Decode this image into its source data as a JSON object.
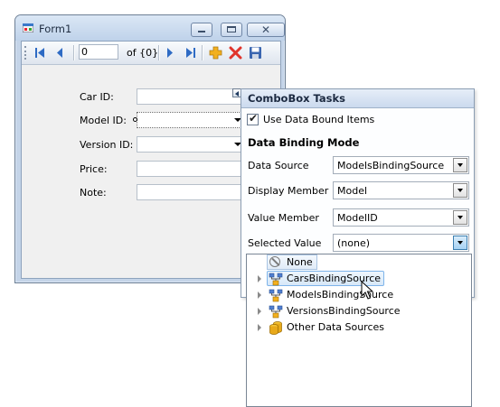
{
  "form": {
    "title": "Form1",
    "icon": "form-app-icon",
    "caption_buttons": [
      "minimize-icon",
      "maximize-icon",
      "close-icon"
    ],
    "close_glyph": "✕"
  },
  "navigator": {
    "position_value": "0",
    "count_label": "of {0}",
    "buttons": [
      "move-first-icon",
      "move-previous-icon",
      "move-next-icon",
      "move-last-icon",
      "add-new-icon",
      "delete-icon",
      "save-icon"
    ]
  },
  "fields": [
    {
      "label": "Car ID:",
      "type": "textbox"
    },
    {
      "label": "Model ID:",
      "type": "combobox",
      "selected": true
    },
    {
      "label": "Version ID:",
      "type": "combobox"
    },
    {
      "label": "Price:",
      "type": "textbox"
    },
    {
      "label": "Note:",
      "type": "textbox"
    }
  ],
  "tasks_panel": {
    "title": "ComboBox Tasks",
    "use_data_bound_items": {
      "label": "Use Data Bound Items",
      "checked": true,
      "check_glyph": "✔"
    },
    "section_title": "Data Binding Mode",
    "properties": [
      {
        "label": "Data Source",
        "value": "ModelsBindingSource"
      },
      {
        "label": "Display Member",
        "value": "Model"
      },
      {
        "label": "Value Member",
        "value": "ModelID"
      },
      {
        "label": "Selected Value",
        "value": "(none)"
      }
    ]
  },
  "dropdown_tree": {
    "items": [
      {
        "text": "None",
        "icon": "none-icon",
        "expandable": false
      },
      {
        "text": "CarsBindingSource",
        "icon": "binding-source-icon",
        "expandable": true,
        "hovered": true
      },
      {
        "text": "ModelsBindingSource",
        "icon": "binding-source-icon",
        "expandable": true
      },
      {
        "text": "VersionsBindingSource",
        "icon": "binding-source-icon",
        "expandable": true
      },
      {
        "text": "Other Data Sources",
        "icon": "data-sources-icon",
        "expandable": true
      }
    ]
  },
  "colors": {
    "window_frame": "#c4d4e8",
    "client_bg": "#f0f0f0",
    "delete_red": "#e0342b",
    "add_yellow": "#f2b01e",
    "nav_blue": "#2e6bc4"
  }
}
